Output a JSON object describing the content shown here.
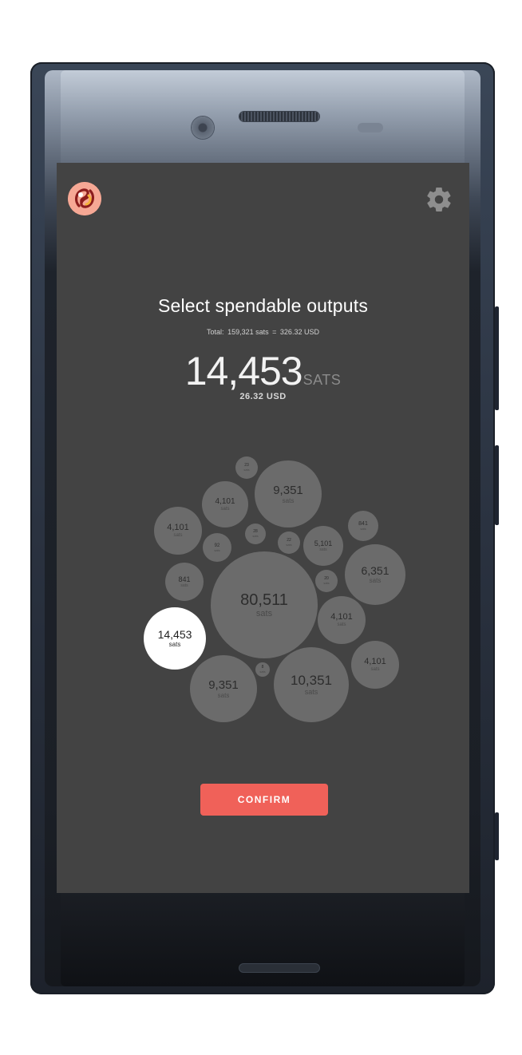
{
  "screen": {
    "title": "Select spendable outputs",
    "total": {
      "prefix": "Total:",
      "sats": "159,321 sats",
      "equals": "=",
      "usd": "326.32 USD"
    },
    "selected_amount": "14,453",
    "selected_unit": "SATS",
    "selected_usd": "26.32 USD",
    "confirm_label": "CONFIRM"
  },
  "outputs": [
    {
      "value": "23",
      "unit": "sats",
      "selected": false
    },
    {
      "value": "9,351",
      "unit": "sats",
      "selected": false
    },
    {
      "value": "4,101",
      "unit": "sats",
      "selected": false
    },
    {
      "value": "841",
      "unit": "sats",
      "selected": false
    },
    {
      "value": "4,101",
      "unit": "sats",
      "selected": false
    },
    {
      "value": "28",
      "unit": "sats",
      "selected": false
    },
    {
      "value": "22",
      "unit": "sats",
      "selected": false
    },
    {
      "value": "5,101",
      "unit": "sats",
      "selected": false
    },
    {
      "value": "92",
      "unit": "sats",
      "selected": false
    },
    {
      "value": "6,351",
      "unit": "sats",
      "selected": false
    },
    {
      "value": "841",
      "unit": "sats",
      "selected": false
    },
    {
      "value": "20",
      "unit": "sats",
      "selected": false
    },
    {
      "value": "80,511",
      "unit": "sats",
      "selected": false
    },
    {
      "value": "4,101",
      "unit": "sats",
      "selected": false
    },
    {
      "value": "14,453",
      "unit": "sats",
      "selected": true
    },
    {
      "value": "4,101",
      "unit": "sats",
      "selected": false
    },
    {
      "value": "8",
      "unit": "sats",
      "selected": false
    },
    {
      "value": "9,351",
      "unit": "sats",
      "selected": false
    },
    {
      "value": "10,351",
      "unit": "sats",
      "selected": false
    }
  ],
  "icons": {
    "logo": "app-logo-icon",
    "settings": "gear-icon"
  },
  "colors": {
    "screen_bg": "#434343",
    "bubble": "#6b6b6b",
    "bubble_selected": "#ffffff",
    "confirm": "#f06159"
  }
}
